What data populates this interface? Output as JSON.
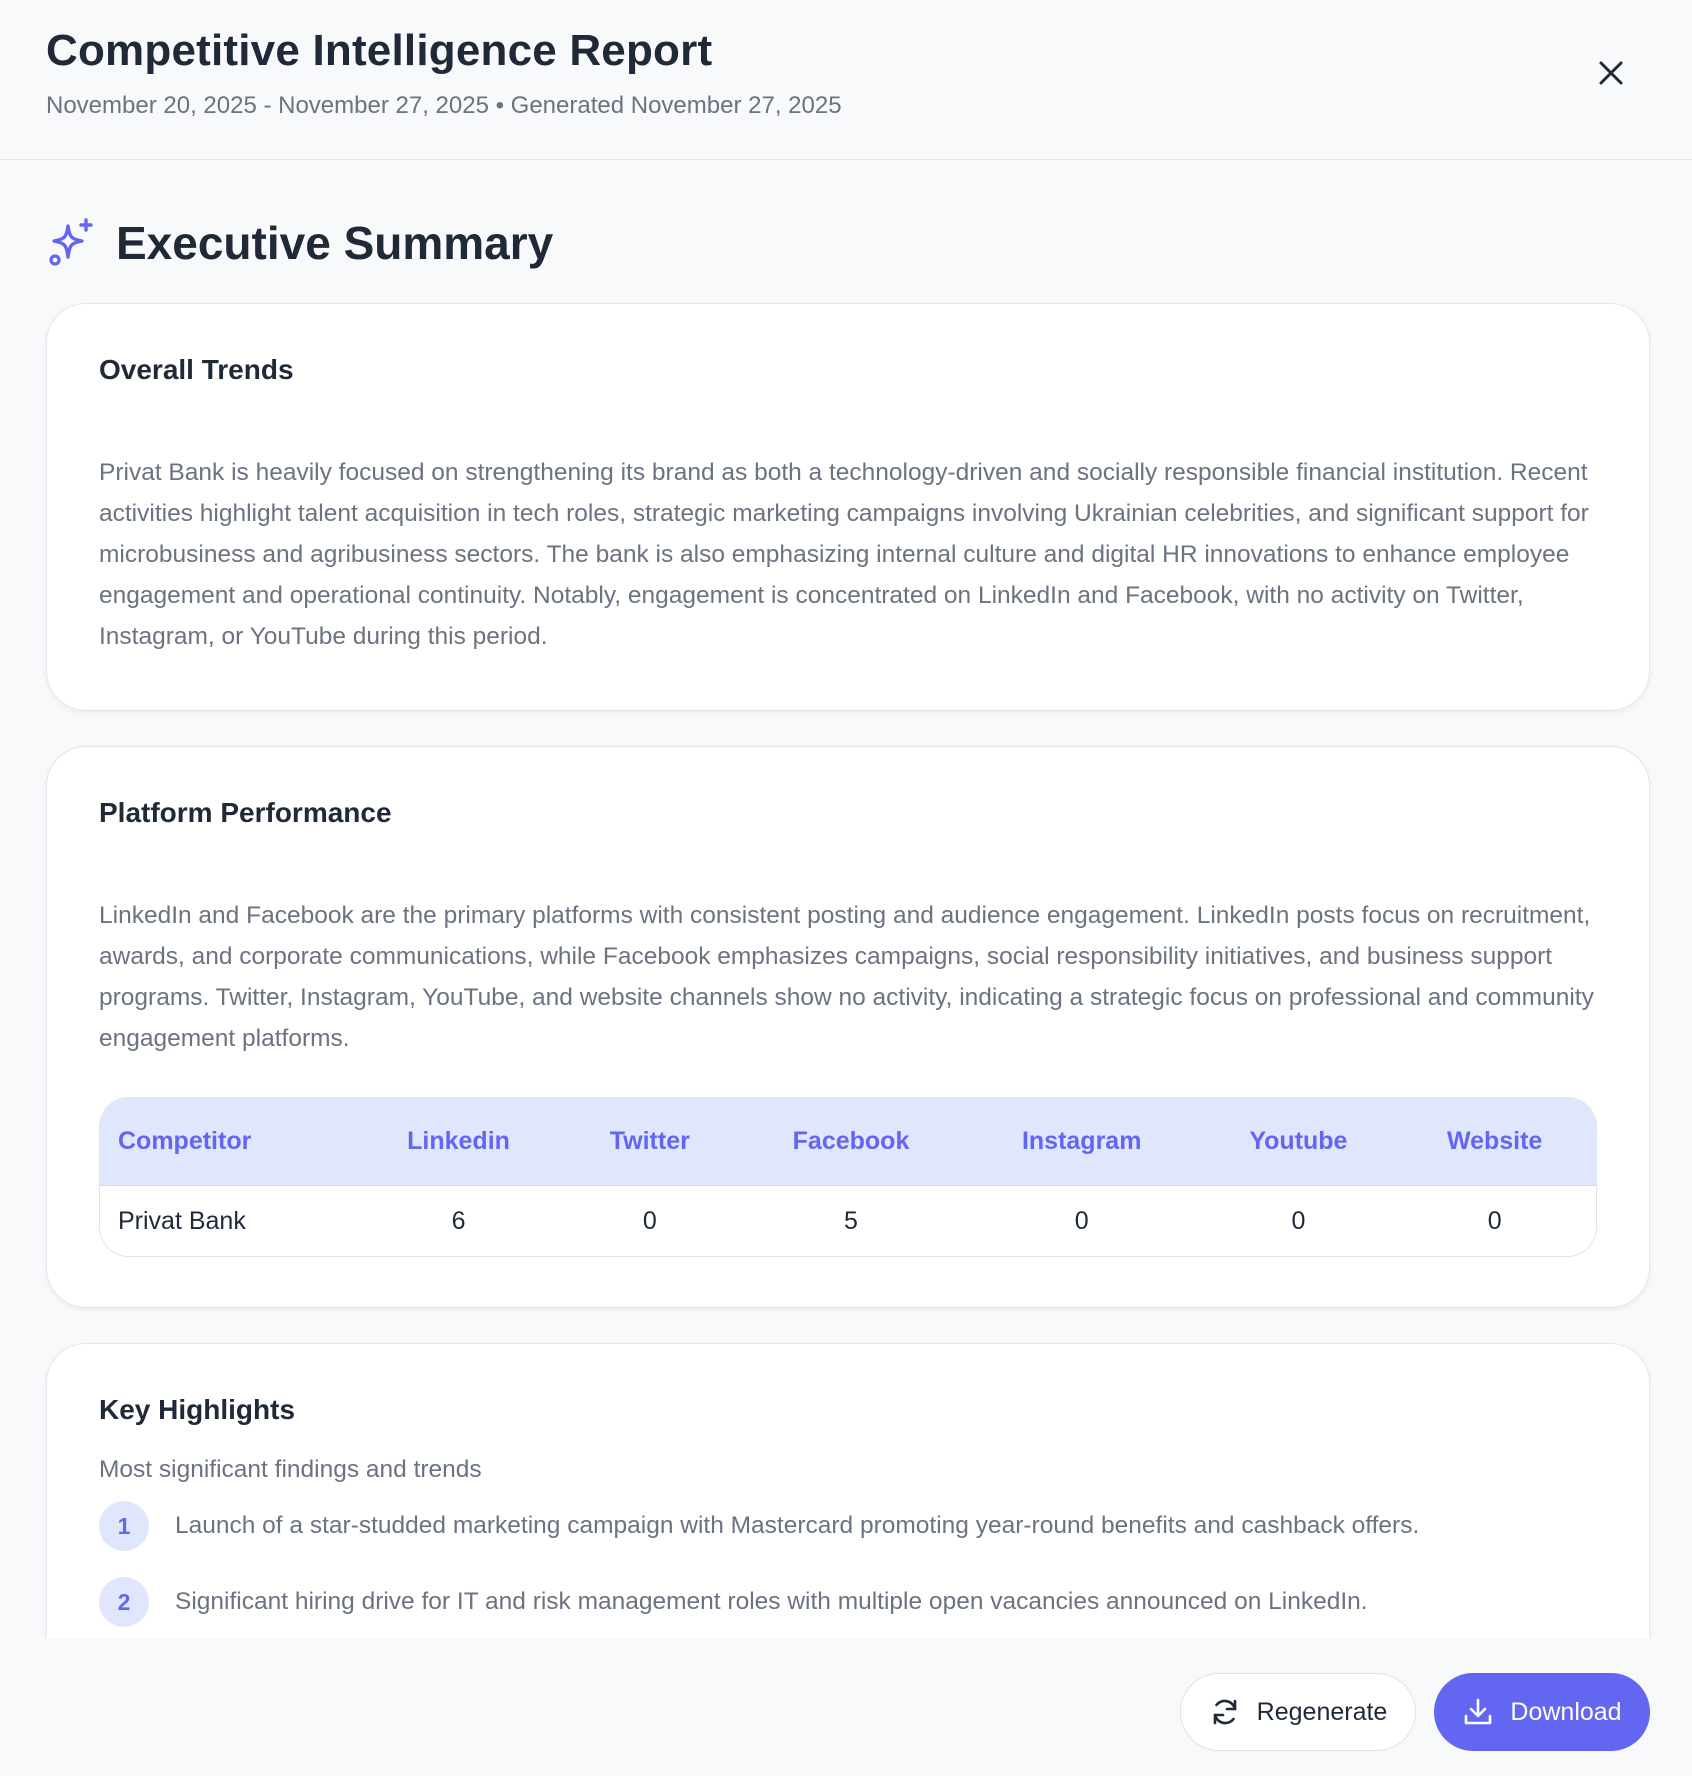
{
  "header": {
    "title": "Competitive Intelligence Report",
    "subtitle": "November 20, 2025 - November 27, 2025 • Generated November 27, 2025",
    "close_icon": "close-icon"
  },
  "section": {
    "title": "Executive Summary",
    "icon": "sparkle-icon",
    "accent_color": "#6366f1"
  },
  "overall_trends": {
    "title": "Overall Trends",
    "text": "Privat Bank is heavily focused on strengthening its brand as both a technology-driven and socially responsible financial institution. Recent activities highlight talent acquisition in tech roles, strategic marketing campaigns involving Ukrainian celebrities, and significant support for microbusiness and agribusiness sectors. The bank is also emphasizing internal culture and digital HR innovations to enhance employee engagement and operational continuity. Notably, engagement is concentrated on LinkedIn and Facebook, with no activity on Twitter, Instagram, or YouTube during this period."
  },
  "platform_performance": {
    "title": "Platform Performance",
    "text": "LinkedIn and Facebook are the primary platforms with consistent posting and audience engagement. LinkedIn posts focus on recruitment, awards, and corporate communications, while Facebook emphasizes campaigns, social responsibility initiatives, and business support programs. Twitter, Instagram, YouTube, and website channels show no activity, indicating a strategic focus on professional and community engagement platforms.",
    "table": {
      "headers": [
        "Competitor",
        "Linkedin",
        "Twitter",
        "Facebook",
        "Instagram",
        "Youtube",
        "Website"
      ],
      "rows": [
        [
          "Privat Bank",
          "6",
          "0",
          "5",
          "0",
          "0",
          "0"
        ]
      ]
    }
  },
  "key_highlights": {
    "title": "Key Highlights",
    "subtitle": "Most significant findings and trends",
    "items": [
      {
        "num": "1",
        "text": "Launch of a star-studded marketing campaign with Mastercard promoting year-round benefits and cashback offers."
      },
      {
        "num": "2",
        "text": "Significant hiring drive for IT and risk management roles with multiple open vacancies announced on LinkedIn."
      }
    ]
  },
  "footer": {
    "regenerate_label": "Regenerate",
    "regenerate_icon": "refresh-icon",
    "download_label": "Download",
    "download_icon": "download-icon"
  }
}
